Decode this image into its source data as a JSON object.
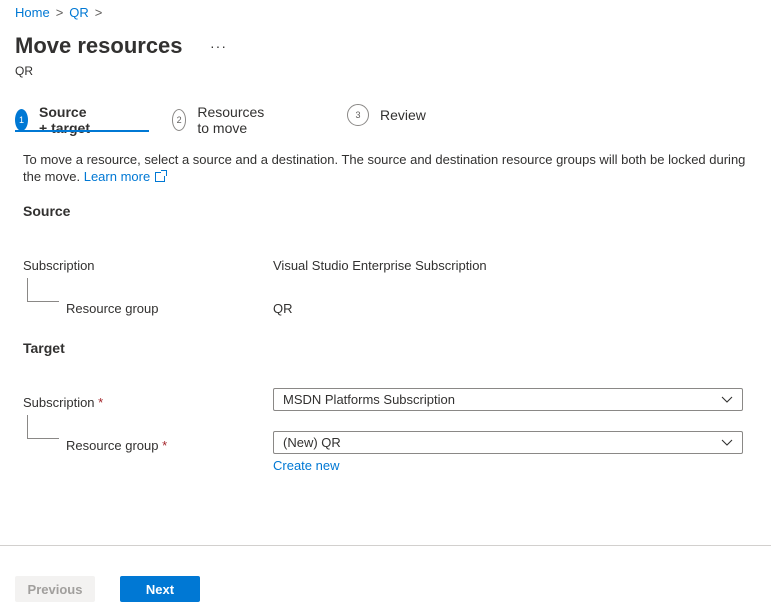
{
  "breadcrumb": {
    "items": [
      "Home",
      "QR"
    ],
    "separator": ">"
  },
  "header": {
    "title": "Move resources",
    "subtitle": "QR",
    "more_label": "···"
  },
  "steps": [
    {
      "number": "1",
      "label": "Source + target",
      "active": true
    },
    {
      "number": "2",
      "label": "Resources to move",
      "active": false
    },
    {
      "number": "3",
      "label": "Review",
      "active": false
    }
  ],
  "description": {
    "text": "To move a resource, select a source and a destination. The source and destination resource groups will both be locked during the move.",
    "link_label": "Learn more"
  },
  "source": {
    "heading": "Source",
    "subscription_label": "Subscription",
    "subscription_value": "Visual Studio Enterprise Subscription",
    "resource_group_label": "Resource group",
    "resource_group_value": "QR"
  },
  "target": {
    "heading": "Target",
    "subscription_label": "Subscription",
    "subscription_value": "MSDN Platforms Subscription",
    "resource_group_label": "Resource group",
    "resource_group_value": "(New) QR",
    "required_marker": "*",
    "create_new_label": "Create new"
  },
  "footer": {
    "previous_label": "Previous",
    "next_label": "Next"
  },
  "colors": {
    "accent": "#0078d4",
    "text": "#323130",
    "required": "#a4262c",
    "disabled_bg": "#f3f2f1"
  }
}
